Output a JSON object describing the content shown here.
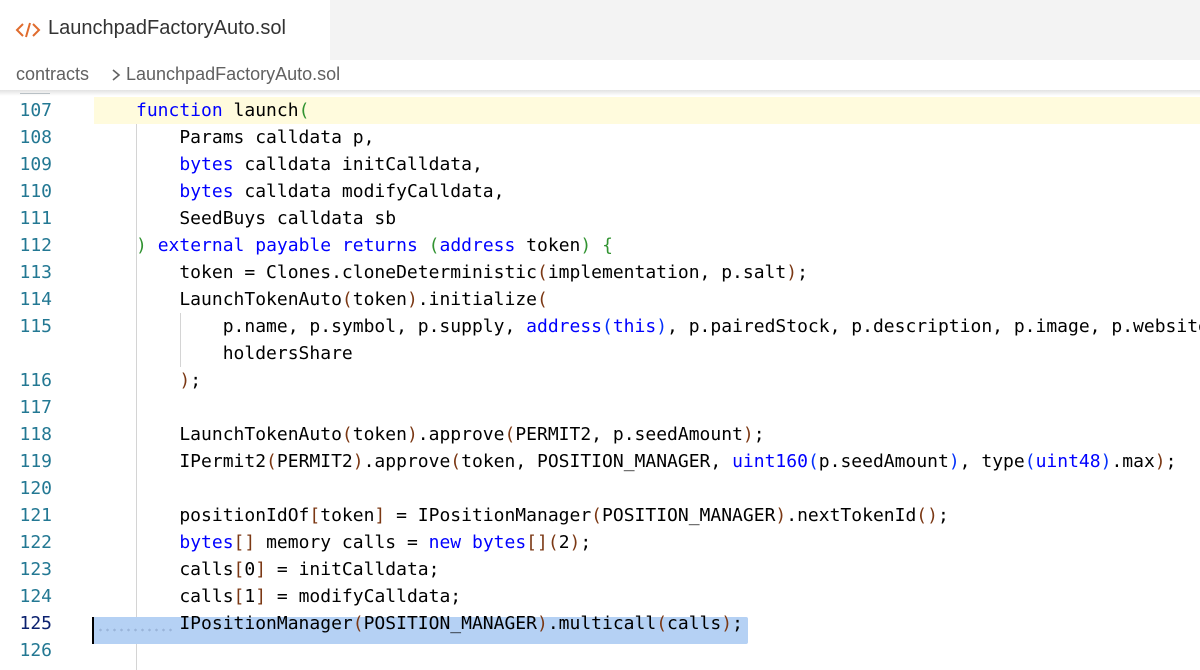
{
  "tab": {
    "icon": "code-file-icon",
    "title": "LaunchpadFactoryAuto.sol"
  },
  "breadcrumb": {
    "folder": "contracts",
    "separator_icon": "chevron-right-icon",
    "file": "LaunchpadFactoryAuto.sol"
  },
  "colors": {
    "keyword": "#0000ff",
    "type": "#267f99",
    "line_number": "#237893",
    "active_line_number": "#0b216f",
    "selection": "#b5d1f4",
    "current_line": "#fffbdd"
  },
  "editor": {
    "current_line": 107,
    "selected_line": 125,
    "lines": [
      {
        "num": "107",
        "tokens": [
          {
            "t": "function",
            "c": "kw"
          },
          {
            "t": " launch"
          },
          {
            "t": "(",
            "c": "b1"
          }
        ]
      },
      {
        "num": "108",
        "tokens": [
          {
            "t": "    Params calldata p,"
          }
        ]
      },
      {
        "num": "109",
        "tokens": [
          {
            "t": "    "
          },
          {
            "t": "bytes",
            "c": "kw"
          },
          {
            "t": " calldata initCalldata,"
          }
        ]
      },
      {
        "num": "110",
        "tokens": [
          {
            "t": "    "
          },
          {
            "t": "bytes",
            "c": "kw"
          },
          {
            "t": " calldata modifyCalldata,"
          }
        ]
      },
      {
        "num": "111",
        "tokens": [
          {
            "t": "    SeedBuys calldata sb"
          }
        ]
      },
      {
        "num": "112",
        "tokens": [
          {
            "t": ")",
            "c": "b1"
          },
          {
            "t": " "
          },
          {
            "t": "external",
            "c": "kw"
          },
          {
            "t": " "
          },
          {
            "t": "payable",
            "c": "kw"
          },
          {
            "t": " "
          },
          {
            "t": "returns",
            "c": "kw"
          },
          {
            "t": " "
          },
          {
            "t": "(",
            "c": "b1"
          },
          {
            "t": "address",
            "c": "kw"
          },
          {
            "t": " token"
          },
          {
            "t": ")",
            "c": "b1"
          },
          {
            "t": " "
          },
          {
            "t": "{",
            "c": "b1"
          }
        ]
      },
      {
        "num": "113",
        "tokens": [
          {
            "t": "    token = Clones.cloneDeterministic"
          },
          {
            "t": "(",
            "c": "b2"
          },
          {
            "t": "implementation, p.salt"
          },
          {
            "t": ")",
            "c": "b2"
          },
          {
            "t": ";"
          }
        ]
      },
      {
        "num": "114",
        "tokens": [
          {
            "t": "    LaunchTokenAuto"
          },
          {
            "t": "(",
            "c": "b2"
          },
          {
            "t": "token"
          },
          {
            "t": ")",
            "c": "b2"
          },
          {
            "t": ".initialize"
          },
          {
            "t": "(",
            "c": "b2"
          }
        ]
      },
      {
        "num": "115",
        "tokens": [
          {
            "t": "        p.name, p.symbol, p.supply, "
          },
          {
            "t": "address",
            "c": "kw"
          },
          {
            "t": "(",
            "c": "b3"
          },
          {
            "t": "this",
            "c": "kw"
          },
          {
            "t": ")",
            "c": "b3"
          },
          {
            "t": ", p.pairedStock, p.description, p.image, p.website"
          }
        ]
      },
      {
        "num": "",
        "tokens": [
          {
            "t": "        holdersShare"
          }
        ]
      },
      {
        "num": "116",
        "tokens": [
          {
            "t": "    "
          },
          {
            "t": ")",
            "c": "b2"
          },
          {
            "t": ";"
          }
        ]
      },
      {
        "num": "117",
        "tokens": []
      },
      {
        "num": "118",
        "tokens": [
          {
            "t": "    LaunchTokenAuto"
          },
          {
            "t": "(",
            "c": "b2"
          },
          {
            "t": "token"
          },
          {
            "t": ")",
            "c": "b2"
          },
          {
            "t": ".approve"
          },
          {
            "t": "(",
            "c": "b2"
          },
          {
            "t": "PERMIT2, p.seedAmount"
          },
          {
            "t": ")",
            "c": "b2"
          },
          {
            "t": ";"
          }
        ]
      },
      {
        "num": "119",
        "tokens": [
          {
            "t": "    IPermit2"
          },
          {
            "t": "(",
            "c": "b2"
          },
          {
            "t": "PERMIT2"
          },
          {
            "t": ")",
            "c": "b2"
          },
          {
            "t": ".approve"
          },
          {
            "t": "(",
            "c": "b2"
          },
          {
            "t": "token, POSITION_MANAGER, "
          },
          {
            "t": "uint160",
            "c": "kw"
          },
          {
            "t": "(",
            "c": "b3"
          },
          {
            "t": "p.seedAmount"
          },
          {
            "t": ")",
            "c": "b3"
          },
          {
            "t": ", "
          },
          {
            "t": "type"
          },
          {
            "t": "(",
            "c": "b3"
          },
          {
            "t": "uint48",
            "c": "kw"
          },
          {
            "t": ")",
            "c": "b3"
          },
          {
            "t": ".max"
          },
          {
            "t": ")",
            "c": "b2"
          },
          {
            "t": ";"
          }
        ]
      },
      {
        "num": "120",
        "tokens": []
      },
      {
        "num": "121",
        "tokens": [
          {
            "t": "    positionIdOf"
          },
          {
            "t": "[",
            "c": "b2"
          },
          {
            "t": "token"
          },
          {
            "t": "]",
            "c": "b2"
          },
          {
            "t": " = IPositionManager"
          },
          {
            "t": "(",
            "c": "b2"
          },
          {
            "t": "POSITION_MANAGER"
          },
          {
            "t": ")",
            "c": "b2"
          },
          {
            "t": ".nextTokenId"
          },
          {
            "t": "()",
            "c": "b2"
          },
          {
            "t": ";"
          }
        ]
      },
      {
        "num": "122",
        "tokens": [
          {
            "t": "    "
          },
          {
            "t": "bytes",
            "c": "kw"
          },
          {
            "t": "[]",
            "c": "b2"
          },
          {
            "t": " memory calls = "
          },
          {
            "t": "new",
            "c": "kw"
          },
          {
            "t": " "
          },
          {
            "t": "bytes",
            "c": "kw"
          },
          {
            "t": "[]",
            "c": "b2"
          },
          {
            "t": "(",
            "c": "b2"
          },
          {
            "t": "2"
          },
          {
            "t": ")",
            "c": "b2"
          },
          {
            "t": ";"
          }
        ]
      },
      {
        "num": "123",
        "tokens": [
          {
            "t": "    calls"
          },
          {
            "t": "[",
            "c": "b2"
          },
          {
            "t": "0"
          },
          {
            "t": "]",
            "c": "b2"
          },
          {
            "t": " = initCalldata;"
          }
        ]
      },
      {
        "num": "124",
        "tokens": [
          {
            "t": "    calls"
          },
          {
            "t": "[",
            "c": "b2"
          },
          {
            "t": "1"
          },
          {
            "t": "]",
            "c": "b2"
          },
          {
            "t": " = modifyCalldata;"
          }
        ]
      },
      {
        "num": "125",
        "tokens": [
          {
            "t": "    IPositionManager"
          },
          {
            "t": "(",
            "c": "b2"
          },
          {
            "t": "POSITION_MANAGER"
          },
          {
            "t": ")",
            "c": "b2"
          },
          {
            "t": ".multicall"
          },
          {
            "t": "(",
            "c": "b2"
          },
          {
            "t": "calls"
          },
          {
            "t": ")",
            "c": "b2"
          },
          {
            "t": ";"
          }
        ]
      },
      {
        "num": "126",
        "tokens": []
      }
    ]
  }
}
